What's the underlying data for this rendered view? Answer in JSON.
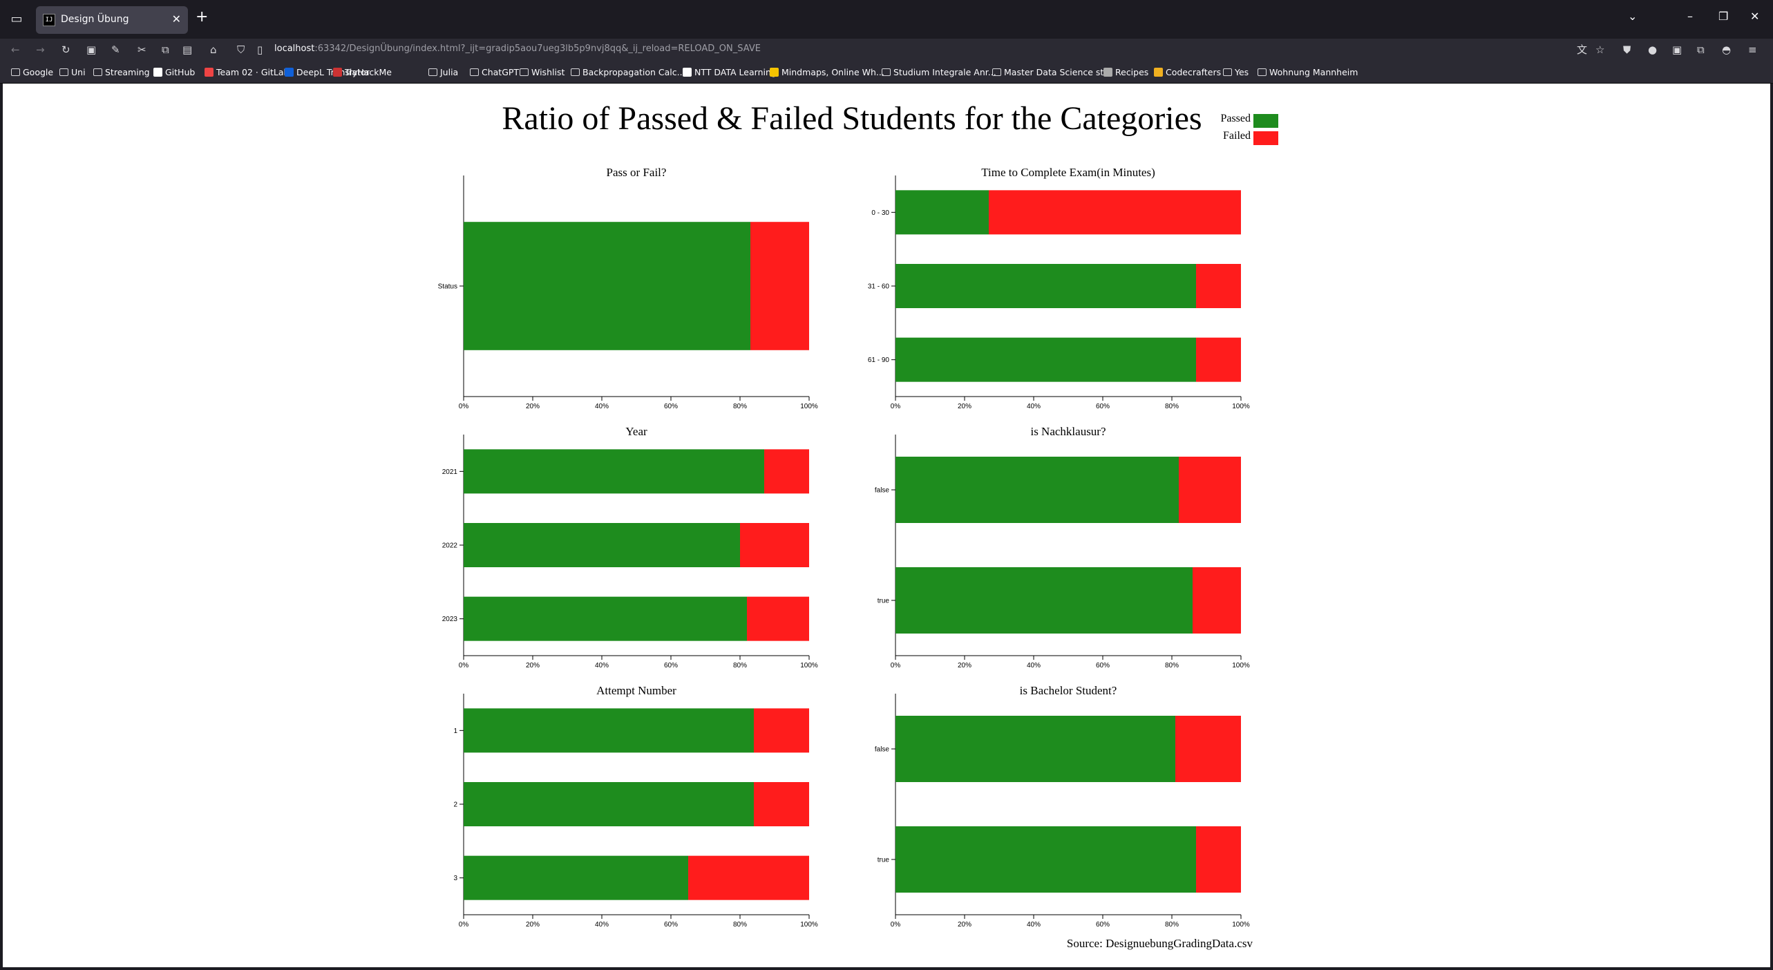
{
  "browser": {
    "tab_title": "Design Übung",
    "url_host": "localhost",
    "url_rest": ":63342/DesignÜbung/index.html?_ijt=gradip5aou7ueg3lb5p9nvj8qq&_ij_reload=RELOAD_ON_SAVE",
    "bookmarks": [
      "Google",
      "Uni",
      "Streaming",
      "GitHub",
      "Team 02 · GitLab",
      "DeepL Translator",
      "TryHackMe",
      "Julia",
      "ChatGPT",
      "Wishlist",
      "Backpropagation Calc...",
      "NTT DATA Learning",
      "Mindmaps, Online Wh...",
      "Studium Integrale Anr...",
      "Master Data Science st...",
      "Recipes",
      "Codecrafters",
      "Yes",
      "Wohnung Mannheim"
    ]
  },
  "page": {
    "title": "Ratio of Passed & Failed Students for the Categories",
    "source": "Source: DesignuebungGradingData.csv"
  },
  "legend": [
    {
      "label": "Passed",
      "color": "#1e8c1e"
    },
    {
      "label": "Failed",
      "color": "#ff1c1c"
    }
  ],
  "colors": {
    "passed": "#1e8c1e",
    "failed": "#ff1c1c"
  },
  "x_ticks": [
    "0%",
    "20%",
    "40%",
    "60%",
    "80%",
    "100%"
  ],
  "chart_data": [
    {
      "type": "bar",
      "stacked": true,
      "orientation": "horizontal",
      "title": "Pass or Fail?",
      "categories": [
        "Status"
      ],
      "series": [
        {
          "name": "Passed",
          "values": [
            0.83
          ]
        },
        {
          "name": "Failed",
          "values": [
            0.17
          ]
        }
      ],
      "xlim": [
        0,
        1
      ]
    },
    {
      "type": "bar",
      "stacked": true,
      "orientation": "horizontal",
      "title": "Time to Complete Exam(in Minutes)",
      "categories": [
        "0 - 30",
        "31 - 60",
        "61 - 90"
      ],
      "series": [
        {
          "name": "Passed",
          "values": [
            0.27,
            0.87,
            0.87
          ]
        },
        {
          "name": "Failed",
          "values": [
            0.73,
            0.13,
            0.13
          ]
        }
      ],
      "xlim": [
        0,
        1
      ]
    },
    {
      "type": "bar",
      "stacked": true,
      "orientation": "horizontal",
      "title": "Year",
      "categories": [
        "2021",
        "2022",
        "2023"
      ],
      "series": [
        {
          "name": "Passed",
          "values": [
            0.87,
            0.8,
            0.82
          ]
        },
        {
          "name": "Failed",
          "values": [
            0.13,
            0.2,
            0.18
          ]
        }
      ],
      "xlim": [
        0,
        1
      ]
    },
    {
      "type": "bar",
      "stacked": true,
      "orientation": "horizontal",
      "title": "is Nachklausur?",
      "categories": [
        "false",
        "true"
      ],
      "series": [
        {
          "name": "Passed",
          "values": [
            0.82,
            0.86
          ]
        },
        {
          "name": "Failed",
          "values": [
            0.18,
            0.14
          ]
        }
      ],
      "xlim": [
        0,
        1
      ]
    },
    {
      "type": "bar",
      "stacked": true,
      "orientation": "horizontal",
      "title": "Attempt Number",
      "categories": [
        "1",
        "2",
        "3"
      ],
      "series": [
        {
          "name": "Passed",
          "values": [
            0.84,
            0.84,
            0.65
          ]
        },
        {
          "name": "Failed",
          "values": [
            0.16,
            0.16,
            0.35
          ]
        }
      ],
      "xlim": [
        0,
        1
      ]
    },
    {
      "type": "bar",
      "stacked": true,
      "orientation": "horizontal",
      "title": "is Bachelor Student?",
      "categories": [
        "false",
        "true"
      ],
      "series": [
        {
          "name": "Passed",
          "values": [
            0.81,
            0.87
          ]
        },
        {
          "name": "Failed",
          "values": [
            0.19,
            0.13
          ]
        }
      ],
      "xlim": [
        0,
        1
      ]
    }
  ]
}
